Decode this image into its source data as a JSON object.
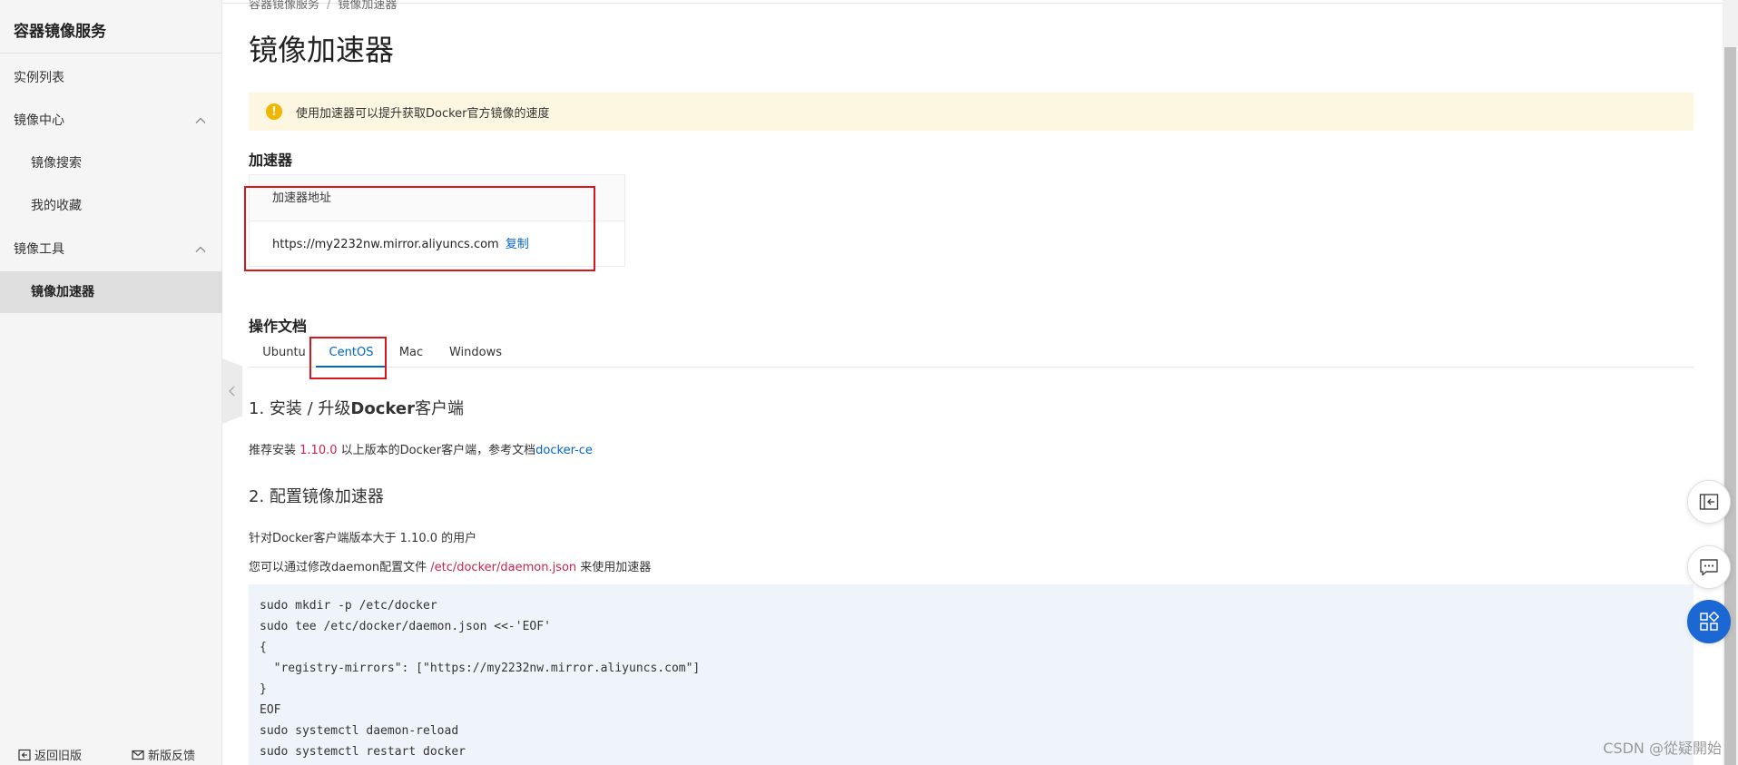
{
  "sidebar": {
    "title": "容器镜像服务",
    "items": [
      {
        "label": "实例列表"
      },
      {
        "label": "镜像中心"
      },
      {
        "label": "镜像搜索"
      },
      {
        "label": "我的收藏"
      },
      {
        "label": "镜像工具"
      },
      {
        "label": "镜像加速器"
      }
    ],
    "footer": {
      "back_label": "返回旧版",
      "feedback_label": "新版反馈"
    }
  },
  "breadcrumb": {
    "items": [
      "容器镜像服务",
      "镜像加速器"
    ]
  },
  "page": {
    "title": "镜像加速器"
  },
  "notice": {
    "text": "使用加速器可以提升获取Docker官方镜像的速度"
  },
  "accelerator": {
    "section_title": "加速器",
    "column_header": "加速器地址",
    "address": "https://my2232nw.mirror.aliyuncs.com",
    "copy_label": "复制"
  },
  "docs": {
    "section_title": "操作文档",
    "tabs": [
      {
        "label": "Ubuntu"
      },
      {
        "label": "CentOS"
      },
      {
        "label": "Mac"
      },
      {
        "label": "Windows"
      }
    ],
    "active_tab": "CentOS",
    "step1": {
      "title_prefix": "1. 安装 / 升级",
      "title_bold": "Docker",
      "title_suffix": "客户端",
      "text_prefix": "推荐安装 ",
      "version": "1.10.0",
      "text_middle": " 以上版本的Docker客户端，参考文档",
      "link": "docker-ce"
    },
    "step2": {
      "title": "2. 配置镜像加速器",
      "line1": "针对Docker客户端版本大于 1.10.0 的用户",
      "line2_prefix": "您可以通过修改daemon配置文件 ",
      "line2_path": "/etc/docker/daemon.json",
      "line2_suffix": " 来使用加速器"
    },
    "code_lines": [
      "sudo mkdir -p /etc/docker",
      "sudo tee /etc/docker/daemon.json <<-'EOF'",
      "{",
      "  \"registry-mirrors\": [\"https://my2232nw.mirror.aliyuncs.com\"]",
      "}",
      "EOF",
      "sudo systemctl daemon-reload",
      "sudo systemctl restart docker"
    ]
  },
  "watermark": "CSDN @從疑開始",
  "colors": {
    "accent": "#ff6a00",
    "link": "#0064c8",
    "highlight_box": "#d9161c",
    "notice_bg": "#fdf6e0",
    "warning_icon": "#f2b600",
    "code_bg": "#eef4fa"
  },
  "icons": {
    "notice": "exclamation-circle-icon",
    "collapse": "chevron-left-icon",
    "float_1": "collapse-panel-icon",
    "float_2": "chat-icon",
    "float_3": "apps-icon"
  }
}
